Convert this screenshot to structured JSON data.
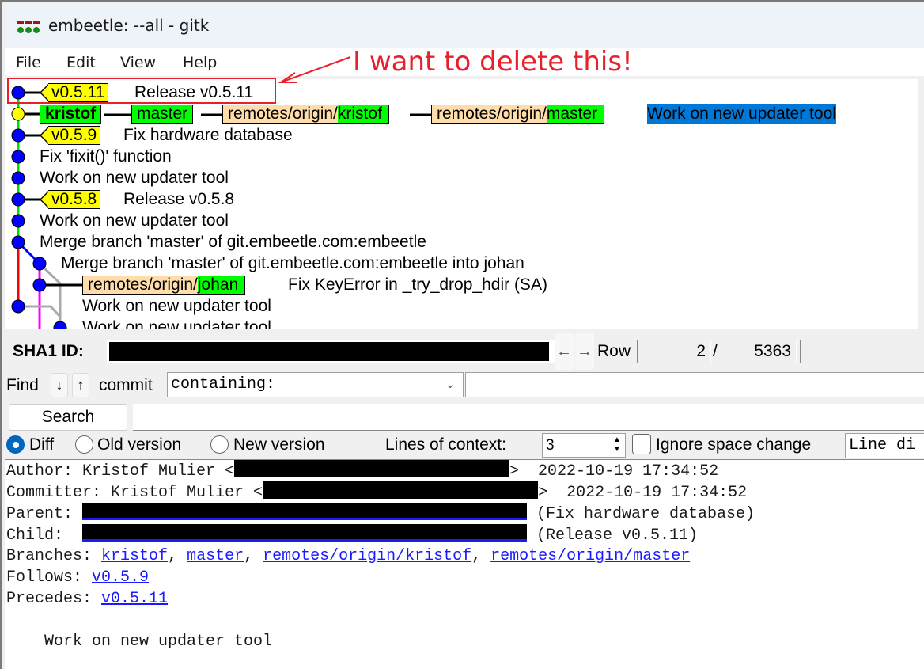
{
  "window": {
    "title": "embeetle: --all - gitk"
  },
  "menu": {
    "items": [
      "File",
      "Edit",
      "View",
      "Help"
    ]
  },
  "annotation": {
    "text": "I want to delete this!",
    "color": "#e8202a"
  },
  "graph": {
    "rows": [
      {
        "tags": [
          "v0.5.11"
        ],
        "branches": [],
        "message": "Release v0.5.11",
        "highlighted": true
      },
      {
        "tags": [],
        "branches": [
          {
            "type": "local",
            "name": "kristof",
            "current": true
          },
          {
            "type": "local",
            "name": "master"
          },
          {
            "type": "remote",
            "prefix": "remotes/origin/",
            "name": "kristof"
          },
          {
            "type": "remote",
            "prefix": "remotes/origin/",
            "name": "master"
          }
        ],
        "message": "Work on new updater tool",
        "selected": true
      },
      {
        "tags": [
          "v0.5.9"
        ],
        "branches": [],
        "message": "Fix hardware database"
      },
      {
        "tags": [],
        "branches": [],
        "message": "Fix 'fixit()' function"
      },
      {
        "tags": [],
        "branches": [],
        "message": "Work on new updater tool"
      },
      {
        "tags": [
          "v0.5.8"
        ],
        "branches": [],
        "message": "Release v0.5.8"
      },
      {
        "tags": [],
        "branches": [],
        "message": "Work on new updater tool"
      },
      {
        "tags": [],
        "branches": [],
        "message": "Merge branch 'master' of git.embeetle.com:embeetle"
      },
      {
        "tags": [],
        "branches": [],
        "message": "Merge branch 'master' of git.embeetle.com:embeetle into johan"
      },
      {
        "tags": [],
        "branches": [
          {
            "type": "remote",
            "prefix": "remotes/origin/",
            "name": "johan"
          }
        ],
        "message": "Fix KeyError in _try_drop_hdir (SA)"
      },
      {
        "tags": [],
        "branches": [],
        "message": "Work on new updater tool"
      },
      {
        "tags": [],
        "branches": [],
        "message": "Work on new updater tool"
      }
    ],
    "colors": {
      "tag_bg": "#ffff00",
      "local_branch_bg": "#00ff00",
      "remote_prefix_bg": "#ffddaa",
      "commit_dot": "#0000ff",
      "current_dot": "#ffff00",
      "selection_bg": "#0078d7"
    }
  },
  "toolbar": {
    "sha_label": "SHA1 ID:",
    "back_icon": "←",
    "forward_icon": "→",
    "row_label": "Row",
    "row_current": "2",
    "row_separator": "/",
    "row_total": "5363"
  },
  "find": {
    "label": "Find",
    "down_icon": "↓",
    "up_icon": "↑",
    "commit_label": "commit",
    "mode_value": "containing:",
    "search_button": "Search",
    "query": ""
  },
  "diff_options": {
    "modes": [
      {
        "label": "Diff",
        "checked": true
      },
      {
        "label": "Old version",
        "checked": false
      },
      {
        "label": "New version",
        "checked": false
      }
    ],
    "context_label": "Lines of context:",
    "context_value": "3",
    "ignore_space_label": "Ignore space change",
    "ignore_space_checked": false,
    "line_diff_value": "Line di"
  },
  "details": {
    "author_label": "Author: Kristof Mulier <",
    "author_suffix": ">  2022-10-19 17:34:52",
    "committer_label": "Committer: Kristof Mulier <",
    "committer_suffix": ">  2022-10-19 17:34:52",
    "parent_label": "Parent: ",
    "parent_desc": " (Fix hardware database)",
    "child_label": "Child:  ",
    "child_desc": " (Release v0.5.11)",
    "branches_label": "Branches: ",
    "branches": [
      "kristof",
      "master",
      "remotes/origin/kristof",
      "remotes/origin/master"
    ],
    "follows_label": "Follows: ",
    "follows": "v0.5.9",
    "precedes_label": "Precedes: ",
    "precedes": "v0.5.11",
    "message": "    Work on new updater tool"
  }
}
